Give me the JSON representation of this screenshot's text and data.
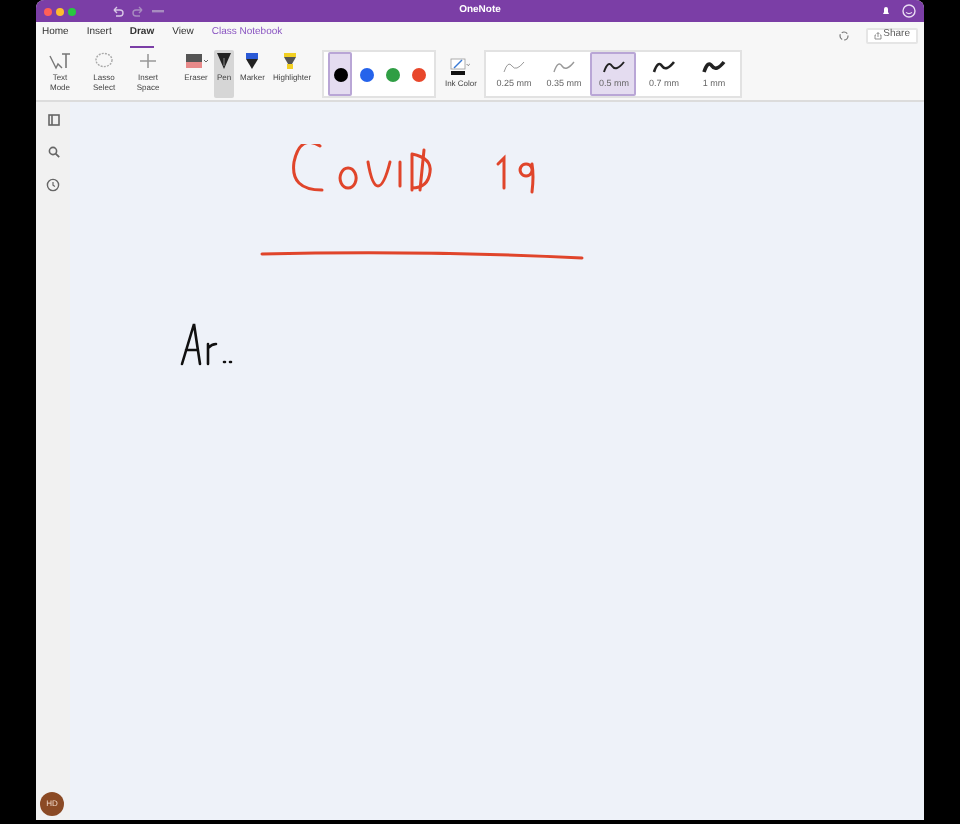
{
  "window": {
    "title": "OneNote"
  },
  "tabs": [
    {
      "label": "Home",
      "selected": false
    },
    {
      "label": "Insert",
      "selected": false
    },
    {
      "label": "Draw",
      "selected": true
    },
    {
      "label": "View",
      "selected": false
    },
    {
      "label": "Class Notebook",
      "selected": false,
      "kind": "accent"
    }
  ],
  "share": {
    "label": "Share"
  },
  "tools": [
    {
      "kind": "text",
      "label": "Text Mode",
      "selected": false
    },
    {
      "kind": "lasso",
      "label": "Lasso Select",
      "selected": false
    },
    {
      "kind": "space",
      "label": "Insert Space",
      "selected": false
    },
    {
      "kind": "eraser",
      "label": "Eraser",
      "selected": false
    },
    {
      "kind": "pen",
      "label": "Pen",
      "selected": true
    },
    {
      "kind": "marker",
      "label": "Marker",
      "selected": false
    },
    {
      "kind": "highlighter",
      "label": "Highlighter",
      "selected": false
    }
  ],
  "colors": [
    {
      "color": "#000000",
      "selected": true
    },
    {
      "color": "#2563eb",
      "selected": false
    },
    {
      "color": "#2f9e44",
      "selected": false
    },
    {
      "color": "#e8472b",
      "selected": false
    }
  ],
  "ink_color": {
    "label": "Ink Color"
  },
  "widths": [
    {
      "label": "0.25 mm",
      "selected": false
    },
    {
      "label": "0.35 mm",
      "selected": false
    },
    {
      "label": "0.5 mm",
      "selected": true
    },
    {
      "label": "0.7 mm",
      "selected": false
    },
    {
      "label": "1 mm",
      "selected": false
    }
  ],
  "account": {
    "initials": "HD"
  }
}
